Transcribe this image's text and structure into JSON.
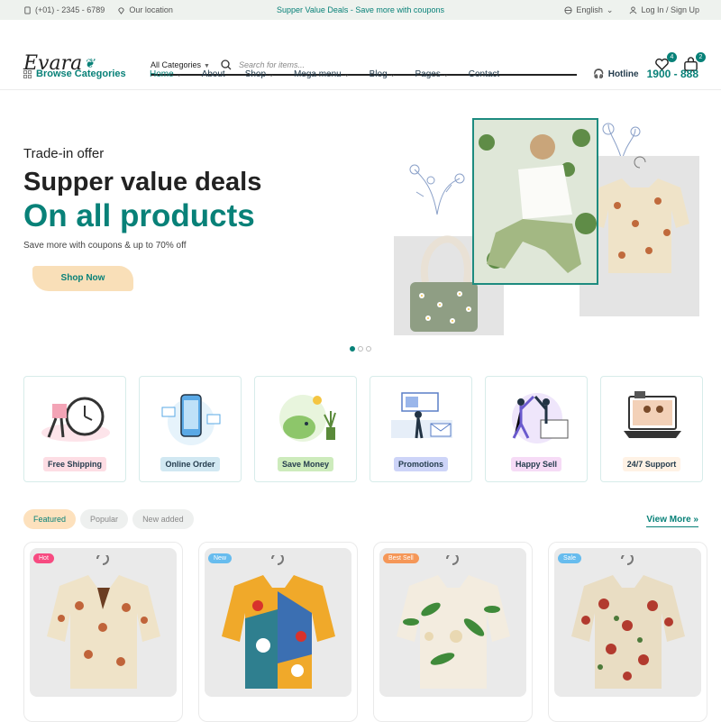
{
  "topbar": {
    "phone": "(+01) - 2345 - 6789",
    "location": "Our location",
    "promo": "Supper Value Deals - Save more with coupons",
    "language": "English",
    "account": "Log In / Sign Up"
  },
  "header": {
    "logo": "Evara",
    "category_select": "All Categories",
    "search_placeholder": "Search for items...",
    "wishlist_count": "4",
    "cart_count": "2"
  },
  "nav": {
    "browse": "Browse Categories",
    "items": [
      "Home",
      "About",
      "Shop",
      "Mega menu",
      "Blog",
      "Pages",
      "Contact"
    ],
    "active": "Home",
    "hotline_label": "Hotline",
    "hotline_number": "1900 - 888"
  },
  "hero": {
    "subtitle": "Trade-in offer",
    "title1": "Supper value deals",
    "title2": "On all products",
    "text": "Save more with coupons & up to 70% off",
    "button": "Shop Now",
    "slides": 3,
    "active_slide": 1
  },
  "features": [
    {
      "label": "Free Shipping",
      "bg": "#fddde4",
      "icon": "shipping-icon"
    },
    {
      "label": "Online Order",
      "bg": "#d1e8f2",
      "icon": "online-order-icon"
    },
    {
      "label": "Save Money",
      "bg": "#cdebbc",
      "icon": "save-money-icon"
    },
    {
      "label": "Promotions",
      "bg": "#cdd4f8",
      "icon": "promotions-icon"
    },
    {
      "label": "Happy Sell",
      "bg": "#f6dbf6",
      "icon": "happy-sell-icon"
    },
    {
      "label": "24/7 Support",
      "bg": "#fff2e5",
      "icon": "support-icon"
    }
  ],
  "tabs": [
    "Featured",
    "Popular",
    "New added"
  ],
  "view_more": "View More »",
  "products": [
    {
      "badge": "Hot",
      "badge_color": "#f74b81"
    },
    {
      "badge": "New",
      "badge_color": "#67bcee"
    },
    {
      "badge": "Best Sell",
      "badge_color": "#f59758"
    },
    {
      "badge": "Sale",
      "badge_color": "#67bcee"
    }
  ],
  "colors": {
    "accent": "#088178",
    "dark": "#222222"
  }
}
